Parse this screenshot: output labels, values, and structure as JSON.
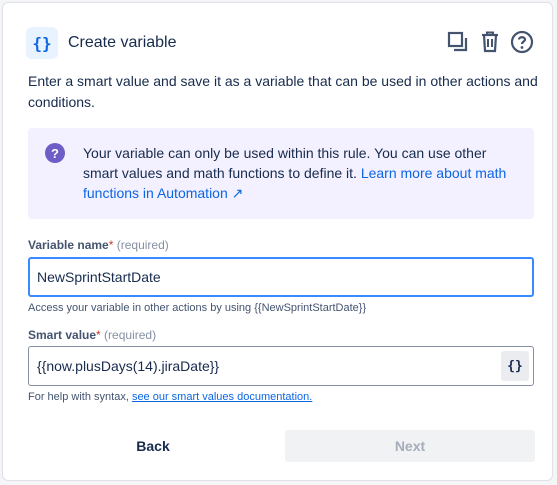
{
  "header": {
    "icon_glyph": "{}",
    "title": "Create variable",
    "actions": [
      "duplicate-icon",
      "trash-icon",
      "help-icon"
    ]
  },
  "description": "Enter a smart value and save it as a variable that can be used in other actions and conditions.",
  "info": {
    "icon_glyph": "?",
    "text": "Your variable can only be used within this rule. You can use other smart values and math functions to define it. ",
    "link_label": "Learn more about math functions in Automation ↗"
  },
  "variable_name": {
    "label": "Variable name",
    "required_mark": "*",
    "required_text": " (required)",
    "value": "NewSprintStartDate",
    "help": "Access your variable in other actions by using {{NewSprintStartDate}}"
  },
  "smart_value": {
    "label": "Smart value",
    "required_mark": "*",
    "required_text": " (required)",
    "value": "{{now.plusDays(14).jiraDate}}",
    "button_glyph": "{}",
    "help_prefix": "For help with syntax, ",
    "help_link": "see our smart values documentation."
  },
  "buttons": {
    "back": "Back",
    "next": "Next"
  },
  "colors": {
    "accent": "#0c66e4",
    "info_bg": "#f3f0ff",
    "info_icon": "#6e5dc6",
    "required": "#c9372c",
    "focus_border": "#388bff"
  }
}
